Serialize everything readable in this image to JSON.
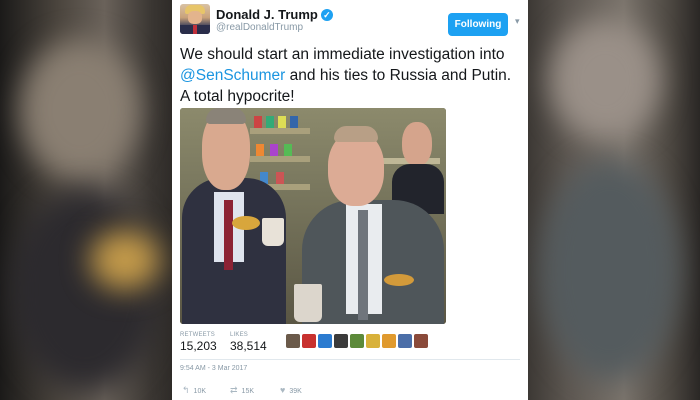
{
  "tweet": {
    "author_name": "Donald J. Trump",
    "handle": "@realDonaldTrump",
    "follow_label": "Following",
    "text_part1": "We should start an immediate investigation into ",
    "mention": "@SenSchumer",
    "text_part2": " and his ties to Russia and Putin. A total hypocrite!",
    "stats": {
      "retweets_label": "RETWEETS",
      "retweets_value": "15,203",
      "likes_label": "LIKES",
      "likes_value": "38,514"
    },
    "timestamp": "9:54 AM - 3 Mar 2017",
    "actions": {
      "reply_count": "10K",
      "retweet_count": "15K",
      "like_count": "39K"
    }
  },
  "icons": {
    "verified": "verified-badge-icon",
    "caret": "chevron-down-icon",
    "reply": "reply-icon",
    "retweet": "retweet-icon",
    "like": "heart-icon"
  },
  "colors": {
    "follow_button": "#1da1f2",
    "mention": "#1b95e0",
    "muted": "#8899a6",
    "text": "#14171a"
  }
}
